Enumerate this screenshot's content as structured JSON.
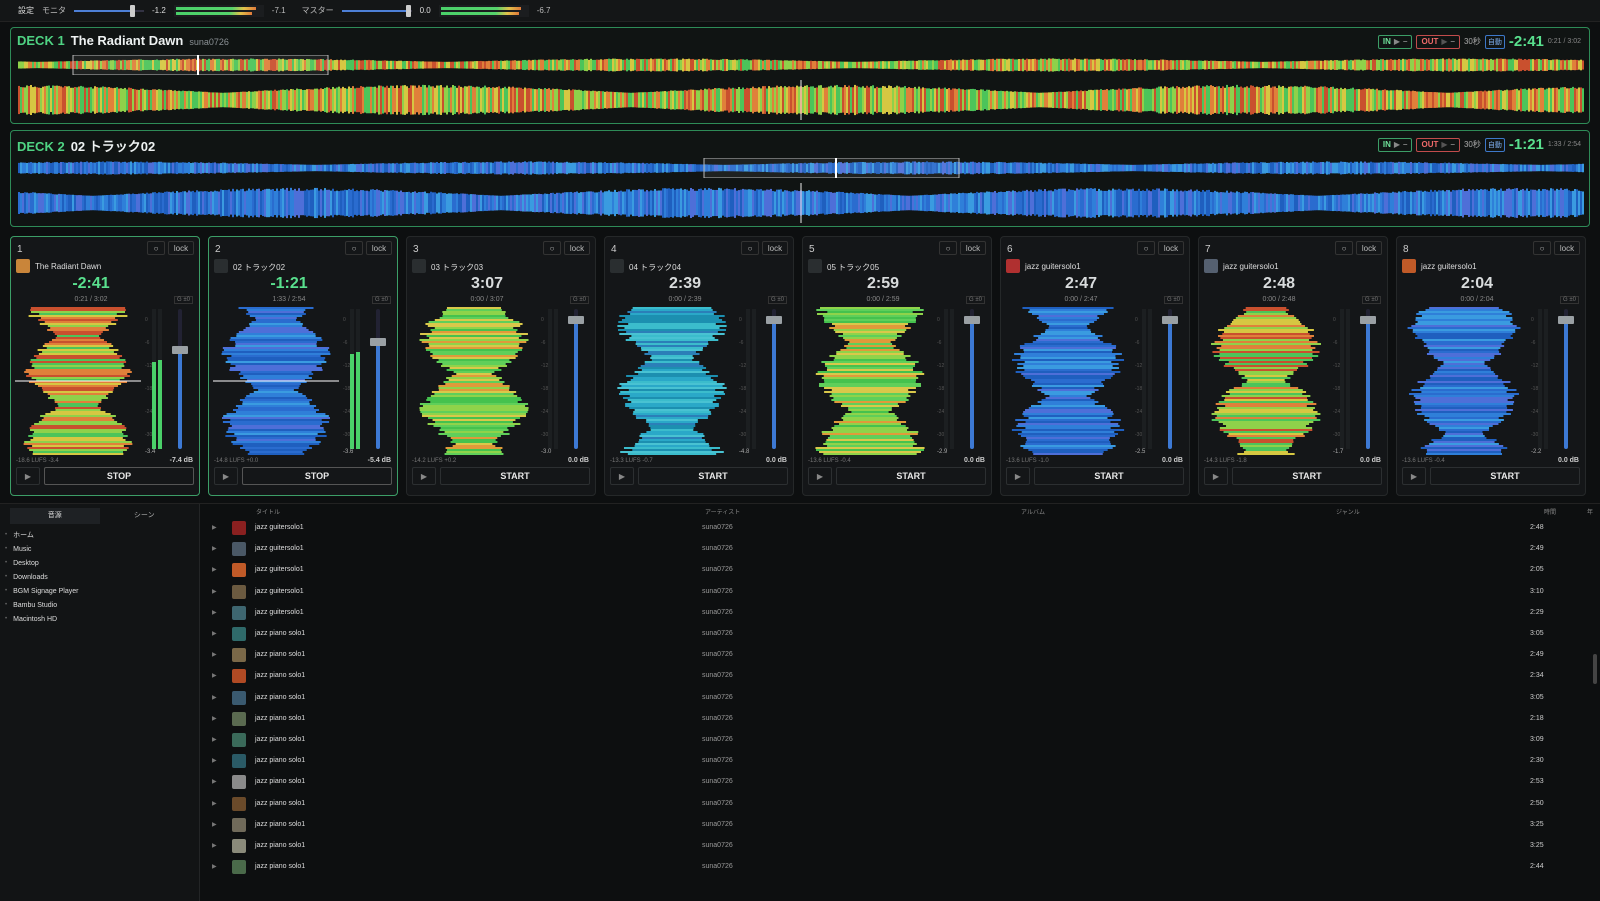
{
  "topbar": {
    "settings": "設定",
    "monitor": "モニタ",
    "monitor_val": "-1.2",
    "monitor_peak": "-7.1",
    "master": "マスター",
    "master_val": "0.0",
    "master_peak": "-6.7",
    "monitor_level": 0.8,
    "master_level": 0.85
  },
  "decks": [
    {
      "label": "DECK 1",
      "track": "The Radiant Dawn",
      "artist": "suna0726",
      "in": "IN",
      "out": "OUT",
      "sec": "30秒",
      "auto": "自動",
      "remain": "-2:41",
      "pos": "0:21 / 3:02",
      "palette": "warm",
      "playhead": 0.5
    },
    {
      "label": "DECK 2",
      "track": "02 トラック02",
      "artist": "",
      "in": "IN",
      "out": "OUT",
      "sec": "30秒",
      "auto": "自動",
      "remain": "-1:21",
      "pos": "1:33 / 2:54",
      "palette": "blue",
      "playhead": 0.5
    }
  ],
  "cards": [
    {
      "num": "1",
      "name": "The Radiant Dawn",
      "time": "-2:41",
      "pos": "0:21 / 3:02",
      "gain": "G ±0",
      "lufs": "-18.6 LUFS -3.4",
      "db": "-7.4 dB",
      "peak": "-3.4",
      "btn": "STOP",
      "active": true,
      "palette": "warm",
      "level": 0.62,
      "fader": 0.72,
      "thumb": "#c9853a"
    },
    {
      "num": "2",
      "name": "02 トラック02",
      "time": "-1:21",
      "pos": "1:33 / 2:54",
      "gain": "G ±0",
      "lufs": "-14.8 LUFS +0.0",
      "db": "-5.4 dB",
      "peak": "-3.6",
      "btn": "STOP",
      "active": true,
      "palette": "blue",
      "level": 0.68,
      "fader": 0.78,
      "thumb": "#2a2e30"
    },
    {
      "num": "3",
      "name": "03 トラック03",
      "time": "3:07",
      "pos": "0:00 / 3:07",
      "gain": "G ±0",
      "lufs": "-14.2 LUFS +0.2",
      "db": "0.0 dB",
      "peak": "-3.0",
      "btn": "START",
      "active": false,
      "palette": "greenyellow",
      "level": 0,
      "fader": 0.95,
      "thumb": "#2a2e30"
    },
    {
      "num": "4",
      "name": "04 トラック04",
      "time": "2:39",
      "pos": "0:00 / 2:39",
      "gain": "G ±0",
      "lufs": "-13.3 LUFS -0.7",
      "db": "0.0 dB",
      "peak": "-4.8",
      "btn": "START",
      "active": false,
      "palette": "teal",
      "level": 0,
      "fader": 0.95,
      "thumb": "#2a2e30"
    },
    {
      "num": "5",
      "name": "05 トラック05",
      "time": "2:59",
      "pos": "0:00 / 2:59",
      "gain": "G ±0",
      "lufs": "-13.6 LUFS -0.4",
      "db": "0.0 dB",
      "peak": "-2.9",
      "btn": "START",
      "active": false,
      "palette": "greenyellow",
      "level": 0,
      "fader": 0.95,
      "thumb": "#2a2e30"
    },
    {
      "num": "6",
      "name": "jazz guitersolo1",
      "time": "2:47",
      "pos": "0:00 / 2:47",
      "gain": "G ±0",
      "lufs": "-13.6 LUFS -1.0",
      "db": "0.0 dB",
      "peak": "-2.5",
      "btn": "START",
      "active": false,
      "palette": "blue",
      "level": 0,
      "fader": 0.95,
      "thumb": "#b03030"
    },
    {
      "num": "7",
      "name": "jazz guitersolo1",
      "time": "2:48",
      "pos": "0:00 / 2:48",
      "gain": "G ±0",
      "lufs": "-14.3 LUFS -1.8",
      "db": "0.0 dB",
      "peak": "-1.7",
      "btn": "START",
      "active": false,
      "palette": "warm",
      "level": 0,
      "fader": 0.95,
      "thumb": "#556070"
    },
    {
      "num": "8",
      "name": "jazz guitersolo1",
      "time": "2:04",
      "pos": "0:00 / 2:04",
      "gain": "G ±0",
      "lufs": "-13.6 LUFS -0.4",
      "db": "0.0 dB",
      "peak": "-2.2",
      "btn": "START",
      "active": false,
      "palette": "blue",
      "level": 0,
      "fader": 0.95,
      "thumb": "#c05a28"
    }
  ],
  "card_ui": {
    "sync": "○",
    "lock": "lock",
    "play": "▶"
  },
  "meter_scale": [
    "0",
    "-6",
    "-12",
    "-18",
    "-24",
    "-30"
  ],
  "sidebar": {
    "tabs": [
      "音源",
      "シーン"
    ],
    "items": [
      "ホーム",
      "Music",
      "Desktop",
      "Downloads",
      "BGM Signage Player",
      "Bambu Studio",
      "Macintosh HD"
    ]
  },
  "list": {
    "headers": {
      "title": "タイトル",
      "artist": "アーティスト",
      "album": "アルバム",
      "genre": "ジャンル",
      "time": "時間",
      "extra": "年"
    },
    "rows": [
      {
        "title": "jazz guitersolo1",
        "artist": "suna0726",
        "time": "2:48",
        "color": "#8a2020"
      },
      {
        "title": "jazz guitersolo1",
        "artist": "suna0726",
        "time": "2:49",
        "color": "#4a5866"
      },
      {
        "title": "jazz guitersolo1",
        "artist": "suna0726",
        "time": "2:05",
        "color": "#c05a28"
      },
      {
        "title": "jazz guitersolo1",
        "artist": "suna0726",
        "time": "3:10",
        "color": "#6b5a40"
      },
      {
        "title": "jazz guitersolo1",
        "artist": "suna0726",
        "time": "2:29",
        "color": "#3e6670"
      },
      {
        "title": "jazz piano solo1",
        "artist": "suna0726",
        "time": "3:05",
        "color": "#2f6a6a"
      },
      {
        "title": "jazz piano solo1",
        "artist": "suna0726",
        "time": "2:49",
        "color": "#7a6848"
      },
      {
        "title": "jazz piano solo1",
        "artist": "suna0726",
        "time": "2:34",
        "color": "#b04a24"
      },
      {
        "title": "jazz piano solo1",
        "artist": "suna0726",
        "time": "3:05",
        "color": "#3a5a70"
      },
      {
        "title": "jazz piano solo1",
        "artist": "suna0726",
        "time": "2:18",
        "color": "#5a6a50"
      },
      {
        "title": "jazz piano solo1",
        "artist": "suna0726",
        "time": "3:09",
        "color": "#3a6a5a"
      },
      {
        "title": "jazz piano solo1",
        "artist": "suna0726",
        "time": "2:30",
        "color": "#2a5a66"
      },
      {
        "title": "jazz piano solo1",
        "artist": "suna0726",
        "time": "2:53",
        "color": "#8a8a8a"
      },
      {
        "title": "jazz piano solo1",
        "artist": "suna0726",
        "time": "2:50",
        "color": "#6a4a2a"
      },
      {
        "title": "jazz piano solo1",
        "artist": "suna0726",
        "time": "3:25",
        "color": "#706a5a"
      },
      {
        "title": "jazz piano solo1",
        "artist": "suna0726",
        "time": "3:25",
        "color": "#8a8a7a"
      },
      {
        "title": "jazz piano solo1",
        "artist": "suna0726",
        "time": "2:44",
        "color": "#4a6a4a"
      }
    ]
  },
  "colors": {
    "accent": "#4fd383",
    "in": "#6fe09a",
    "out": "#f06a6a",
    "fader": "#3d79d4"
  }
}
